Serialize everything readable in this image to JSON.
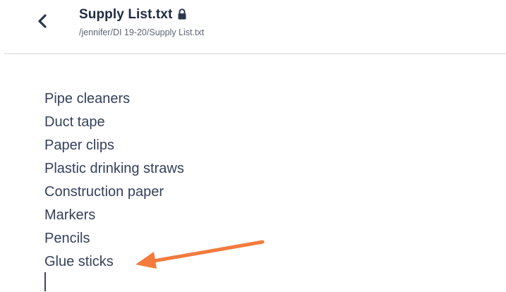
{
  "header": {
    "back_icon": "chevron-left-icon",
    "title": "Supply List.txt",
    "lock_icon": "lock-icon",
    "path": "/jennifer/DI 19-20/Supply List.txt"
  },
  "editor": {
    "lines": [
      "Pipe cleaners",
      "Duct tape",
      "Paper clips",
      "Plastic drinking straws",
      "Construction paper",
      "Markers",
      "Pencils",
      "Glue sticks"
    ]
  },
  "annotation": {
    "arrow_icon": "arrow-left-icon",
    "arrow_color": "#f27b3d"
  },
  "colors": {
    "text": "#33415c",
    "title": "#1f2a44",
    "divider": "#e6e8ec"
  }
}
